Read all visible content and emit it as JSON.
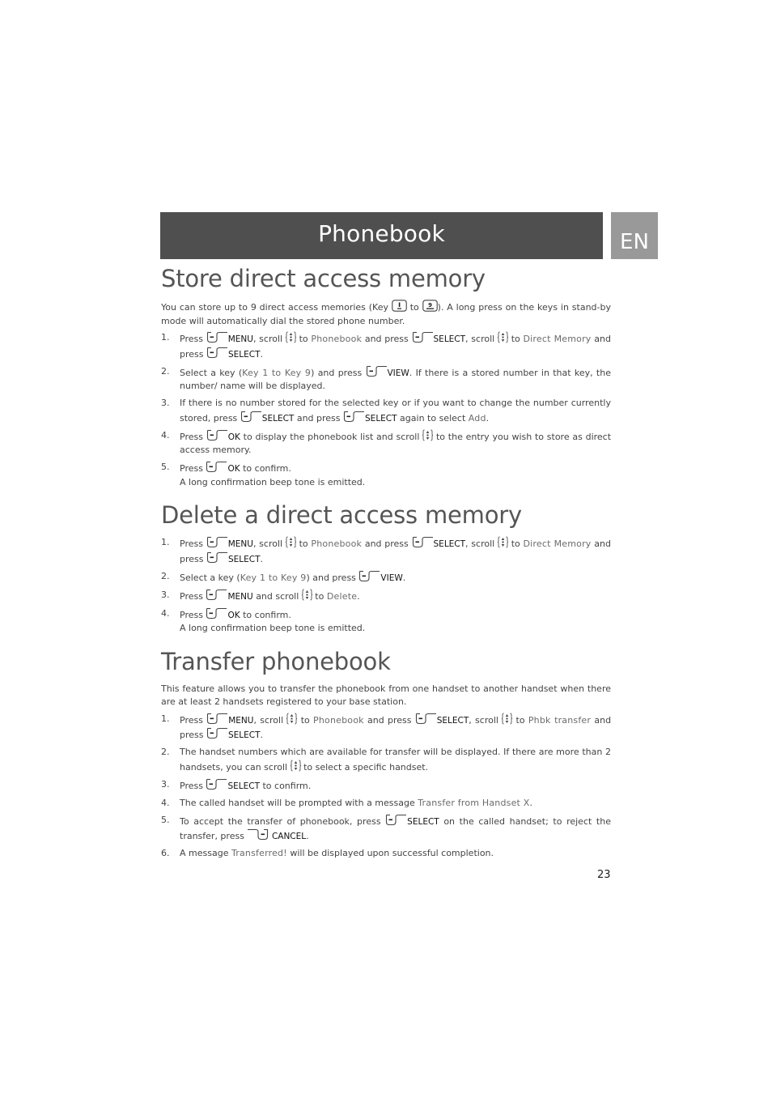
{
  "header": {
    "title": "Phonebook",
    "language_tab": "EN"
  },
  "icons": {
    "left_softkey": "left-softkey-icon",
    "right_softkey": "right-softkey-icon",
    "scroll": "scroll-updown-icon",
    "key_1": "key-1-icon",
    "key_9": "key-9-icon"
  },
  "sections": {
    "store": {
      "title": "Store direct access memory",
      "intro_a": "You can store up to 9 direct access memories (Key",
      "intro_b": "to",
      "intro_c": "). A long press on the keys in stand-by mode will automatically dial the stored phone number.",
      "steps": [
        {
          "num": "1.",
          "t1": "Press",
          "k1": "MENU",
          "t2": ", scroll",
          "t3": "to",
          "m1": "Phonebook",
          "t4": "and press",
          "k2": "SELECT",
          "t5": ", scroll",
          "t6": "to",
          "m2": "Direct Memory",
          "t7": "and press",
          "k3": "SELECT",
          "t8": "."
        },
        {
          "num": "2.",
          "t1": "Select a key (",
          "m1": "Key 1 to Key 9",
          "t2": ") and press",
          "k1": "VIEW",
          "t3": ". If there is a stored number in that key, the number/ name will be displayed."
        },
        {
          "num": "3.",
          "t1": "If there is no number stored for the selected key or if you want to change the number currently stored, press",
          "k1": "SELECT",
          "t2": "and press",
          "k2": "SELECT",
          "t3": "again to select",
          "m1": "Add",
          "t4": "."
        },
        {
          "num": "4.",
          "t1": "Press",
          "k1": "OK",
          "t2": "to display the phonebook list and scroll",
          "t3": "to the entry you wish to store as direct access memory."
        },
        {
          "num": "5.",
          "t1": "Press",
          "k1": "OK",
          "t2": "to confirm.",
          "t3": "A long confirmation beep tone is emitted."
        }
      ]
    },
    "delete": {
      "title": "Delete a direct access memory",
      "steps": [
        {
          "num": "1.",
          "t1": "Press",
          "k1": "MENU",
          "t2": ", scroll",
          "t3": "to",
          "m1": "Phonebook",
          "t4": "and press",
          "k2": "SELECT",
          "t5": ", scroll",
          "t6": "to",
          "m2": "Direct Memory",
          "t7": "and press",
          "k3": "SELECT",
          "t8": "."
        },
        {
          "num": "2.",
          "t1": "Select a key (",
          "m1": "Key 1 to Key 9",
          "t2": ") and press",
          "k1": "VIEW",
          "t3": "."
        },
        {
          "num": "3.",
          "t1": "Press",
          "k1": "MENU",
          "t2": "and scroll",
          "t3": "to",
          "m1": "Delete",
          "t4": "."
        },
        {
          "num": "4.",
          "t1": "Press",
          "k1": "OK",
          "t2": "to confirm.",
          "t3": "A long confirmation beep tone is emitted."
        }
      ]
    },
    "transfer": {
      "title": "Transfer phonebook",
      "intro": "This feature allows you to transfer the phonebook from one handset to another handset when there are at least 2 handsets registered to your base station.",
      "steps": [
        {
          "num": "1.",
          "t1": "Press",
          "k1": "MENU",
          "t2": ", scroll",
          "t3": "to",
          "m1": "Phonebook",
          "t4": "and press",
          "k2": "SELECT",
          "t5": ", scroll",
          "t6": "to",
          "m2": "Phbk transfer",
          "t7": "and press",
          "k3": "SELECT",
          "t8": "."
        },
        {
          "num": "2.",
          "t1": "The handset numbers which are available for transfer will be displayed. If there are more than 2 handsets, you can scroll",
          "t2": "to select a specific handset."
        },
        {
          "num": "3.",
          "t1": "Press",
          "k1": "SELECT",
          "t2": "to confirm."
        },
        {
          "num": "4.",
          "t1": "The called handset will be prompted with a message",
          "m1": "Transfer from Handset X",
          "t2": "."
        },
        {
          "num": "5.",
          "t1": "To accept the transfer of phonebook, press",
          "k1": "SELECT",
          "t2": "on the called handset; to reject the transfer, press",
          "k2": "CANCEL",
          "t3": "."
        },
        {
          "num": "6.",
          "t1": "A message",
          "m1": "Transferred!",
          "t2": "will be displayed upon successful completion."
        }
      ]
    }
  },
  "footer": {
    "page_number": "23"
  }
}
